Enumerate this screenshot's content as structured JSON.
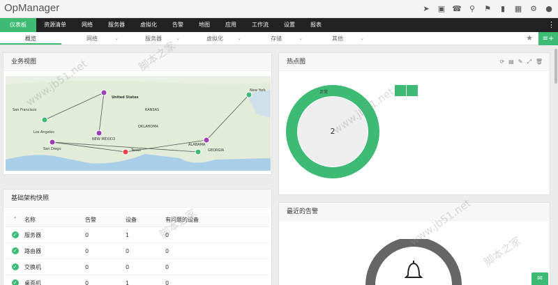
{
  "app": {
    "title": "OpManager"
  },
  "mainnav": [
    {
      "label": "仪表板",
      "active": true
    },
    {
      "label": "资源清单"
    },
    {
      "label": "网络"
    },
    {
      "label": "服务器"
    },
    {
      "label": "虚拟化"
    },
    {
      "label": "告警"
    },
    {
      "label": "地图"
    },
    {
      "label": "应用"
    },
    {
      "label": "工作流"
    },
    {
      "label": "设置"
    },
    {
      "label": "报表"
    }
  ],
  "subnav": [
    {
      "label": "概览",
      "active": true
    },
    {
      "label": "网络"
    },
    {
      "label": "服务器"
    },
    {
      "label": "虚拟化"
    },
    {
      "label": "存储"
    },
    {
      "label": "其他"
    }
  ],
  "business_view": {
    "title": "业务视图",
    "labels": [
      "United States",
      "San Francisco",
      "Los Angeles",
      "San Diego",
      "NEW MEXICO",
      "New York",
      "KANSAS",
      "OKLAHOMA",
      "GEORGIA",
      "ALABAMA",
      "Texas"
    ]
  },
  "heatmap": {
    "title": "热点图",
    "donut_label": "正常",
    "donut_value": "2"
  },
  "infra": {
    "title": "基础架构快照",
    "columns": [
      "名称",
      "告警",
      "设备",
      "有问题的设备"
    ],
    "rows": [
      [
        "服务器",
        "0",
        "1",
        "0"
      ],
      [
        "路由器",
        "0",
        "0",
        "0"
      ],
      [
        "交换机",
        "0",
        "0",
        "0"
      ],
      [
        "桌面机",
        "0",
        "1",
        "0"
      ]
    ]
  },
  "alarms": {
    "title": "最近的告警"
  },
  "watermark": {
    "text": "脚本之家",
    "url": "www.jb51.net"
  }
}
